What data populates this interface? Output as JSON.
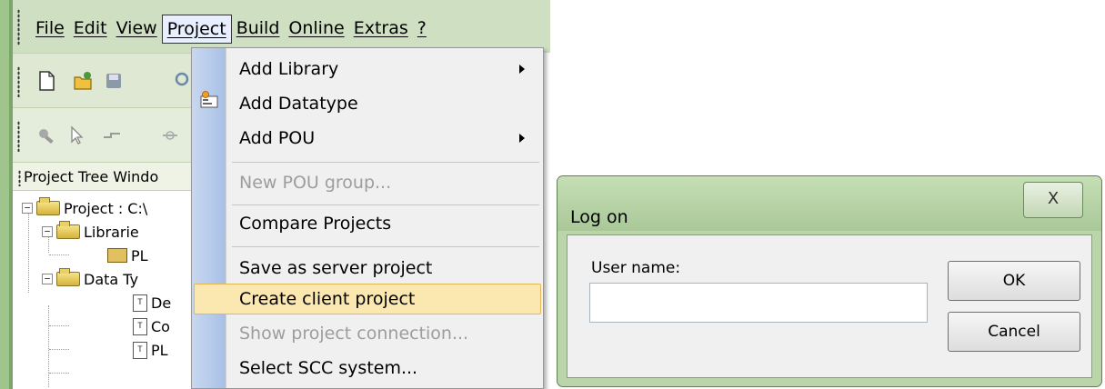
{
  "menubar": {
    "items": [
      {
        "label": "File"
      },
      {
        "label": "Edit"
      },
      {
        "label": "View"
      },
      {
        "label": "Project"
      },
      {
        "label": "Build"
      },
      {
        "label": "Online"
      },
      {
        "label": "Extras"
      },
      {
        "label": "?"
      }
    ]
  },
  "toolbar": {
    "icons": [
      "new-file-icon",
      "open-folder-icon",
      "save-icon",
      "search-icon"
    ],
    "icons2": [
      "wrench-icon",
      "pointer-icon",
      "connector-icon",
      "breakpoint-icon"
    ]
  },
  "project_tree": {
    "header": "Project Tree Windo",
    "rows": [
      {
        "label": "Project : C:\\"
      },
      {
        "label": "Librarie"
      },
      {
        "label": "PL"
      },
      {
        "label": "Data Ty"
      },
      {
        "label": "De"
      },
      {
        "label": "Co"
      },
      {
        "label": "PL"
      }
    ]
  },
  "project_menu": {
    "items": [
      {
        "label": "Add Library",
        "submenu": true,
        "enabled": true
      },
      {
        "label": "Add Datatype",
        "submenu": false,
        "enabled": true
      },
      {
        "label": "Add POU",
        "submenu": true,
        "enabled": true
      },
      {
        "label": "New POU group...",
        "submenu": false,
        "enabled": false
      },
      {
        "label": "Compare Projects",
        "submenu": false,
        "enabled": true
      },
      {
        "label": "Save as server project",
        "submenu": false,
        "enabled": true
      },
      {
        "label": "Create client project",
        "submenu": false,
        "enabled": true,
        "highlighted": true
      },
      {
        "label": "Show project connection...",
        "submenu": false,
        "enabled": false
      },
      {
        "label": "Select SCC system...",
        "submenu": false,
        "enabled": true
      }
    ]
  },
  "logon_dialog": {
    "title": "Log on",
    "close_label": "X",
    "user_name_label": "User name:",
    "user_name_value": "",
    "ok_label": "OK",
    "cancel_label": "Cancel"
  },
  "colors": {
    "window_frame": "#b9d5a9",
    "menu_highlight": "#fbe7b0",
    "disabled_text": "#9d9d9d"
  }
}
